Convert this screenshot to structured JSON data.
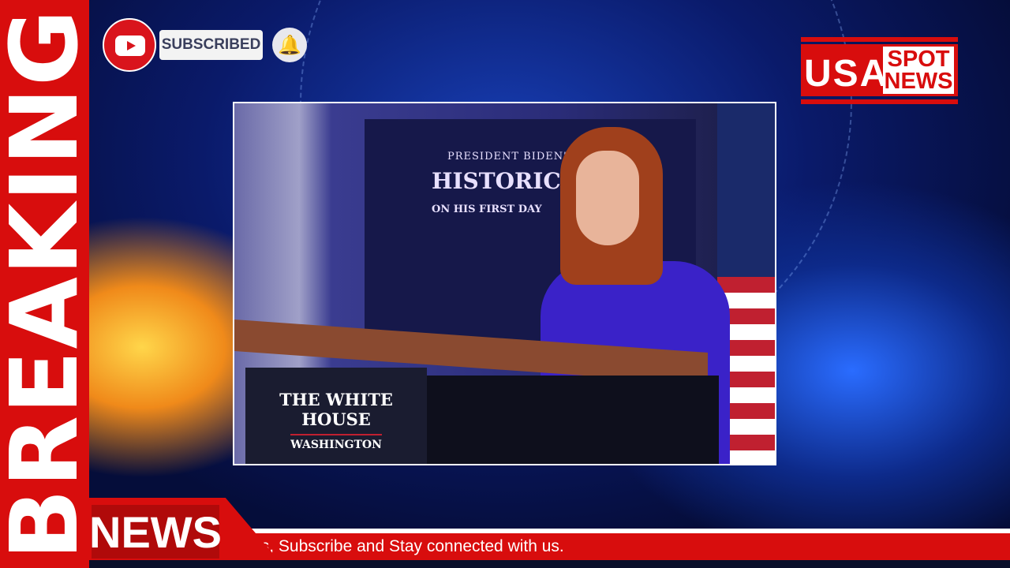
{
  "banner": {
    "side_text": "BREAKING",
    "news_label": "NEWS",
    "ticker_text": "Updates, Subscribe and Stay connected with us."
  },
  "youtube": {
    "subscribed_label": "SUBSCRIBED",
    "icons": [
      "youtube-play-icon",
      "bell-icon"
    ]
  },
  "logo": {
    "usa": "USA",
    "spot": "SPOT",
    "news": "NEWS"
  },
  "photo": {
    "screen_line1": "PRESIDENT BIDEN'S",
    "screen_line2": "HISTORIC A",
    "screen_line3": "ON HIS FIRST DAY",
    "podium_line1": "THE WHITE HOUSE",
    "podium_line2": "WASHINGTON"
  },
  "colors": {
    "red": "#d80d0d",
    "blue": "#0a1a6a"
  }
}
